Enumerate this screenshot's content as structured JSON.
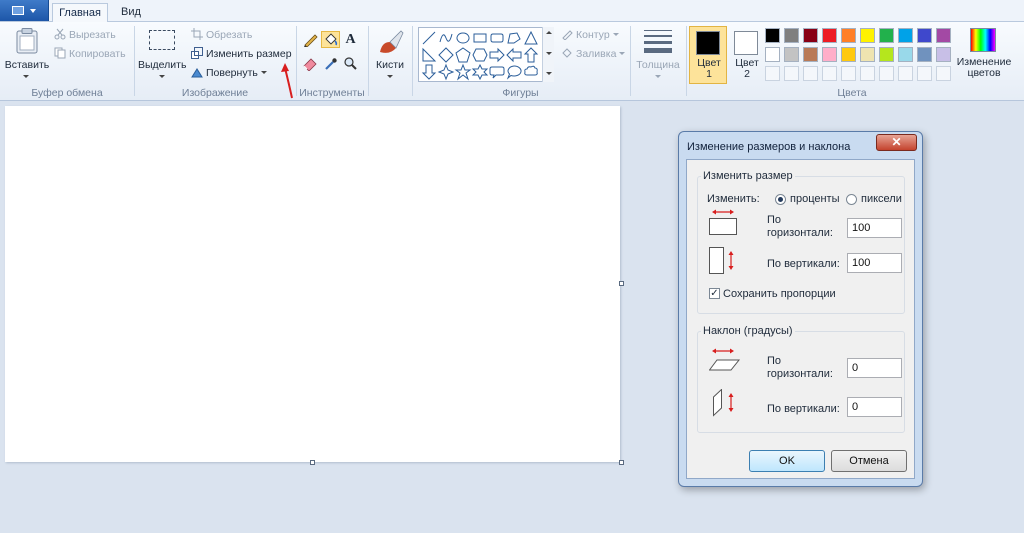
{
  "tabs": {
    "home": "Главная",
    "view": "Вид"
  },
  "clipboard": {
    "paste": "Вставить",
    "cut": "Вырезать",
    "copy": "Копировать",
    "group": "Буфер обмена"
  },
  "image": {
    "select": "Выделить",
    "crop": "Обрезать",
    "resize": "Изменить размер",
    "rotate": "Повернуть",
    "group": "Изображение"
  },
  "tools": {
    "group": "Инструменты"
  },
  "brushes": {
    "label": "Кисти"
  },
  "shapes": {
    "group": "Фигуры",
    "outline": "Контур",
    "fill": "Заливка"
  },
  "size": {
    "label": "Толщина"
  },
  "colors": {
    "color1": "Цвет\n1",
    "color2": "Цвет\n2",
    "edit": "Изменение\nцветов",
    "group": "Цвета",
    "color1_value": "#000000",
    "color2_value": "#ffffff",
    "palette_row1": [
      "#000000",
      "#7f7f7f",
      "#880015",
      "#ed1c24",
      "#ff7f27",
      "#fff200",
      "#22b14c",
      "#00a2e8",
      "#3f48cc",
      "#a349a4"
    ],
    "palette_row2": [
      "#ffffff",
      "#c3c3c3",
      "#b97a57",
      "#ffaec9",
      "#ffc90e",
      "#efe4b0",
      "#b5e61d",
      "#99d9ea",
      "#7092be",
      "#c8bfe7"
    ]
  },
  "dialog": {
    "title": "Изменение размеров и наклона",
    "close": "✕",
    "resize_group": "Изменить размер",
    "change_by": "Изменить:",
    "percent": "проценты",
    "pixels": "пиксели",
    "horizontal": "По\nгоризонтали:",
    "vertical": "По вертикали:",
    "resize_h": "100",
    "resize_v": "100",
    "keep_ratio": "Сохранить пропорции",
    "skew_group": "Наклон (градусы)",
    "skew_h_label": "По\nгоризонтали:",
    "skew_v_label": "По вертикали:",
    "skew_h": "0",
    "skew_v": "0",
    "ok": "OK",
    "cancel": "Отмена"
  }
}
